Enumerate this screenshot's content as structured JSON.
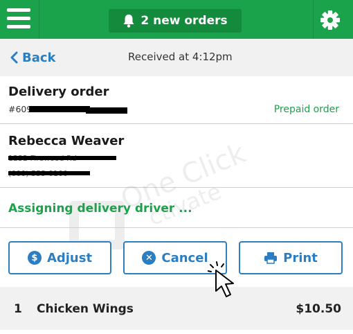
{
  "header": {
    "notification_label": "2 new orders",
    "bell_icon": "bell-icon",
    "menu_icon": "hamburger-menu-icon",
    "settings_icon": "gear-icon"
  },
  "nav": {
    "back_label": "Back",
    "received_text": "Received at 4:12pm"
  },
  "order": {
    "type_label": "Delivery order",
    "number_prefix": "#6090743?-3?8",
    "payment_status": "Prepaid order"
  },
  "customer": {
    "name": "Rebecca Weaver",
    "address": "1232 Firewood Rd",
    "phone": "(000) 555-0100"
  },
  "status": {
    "assigning_text": "Assigning delivery driver ..."
  },
  "actions": {
    "adjust_label": "Adjust",
    "cancel_label": "Cancel",
    "print_label": "Print"
  },
  "items": [
    {
      "qty": "1",
      "name": "Chicken Wings",
      "price": "$10.50"
    }
  ],
  "watermark": {
    "line1": "One Click",
    "line2": "ctivate"
  },
  "colors": {
    "brand_green": "#1aa34a",
    "dark_green": "#138a3c",
    "accent_blue": "#2b7ec1"
  }
}
